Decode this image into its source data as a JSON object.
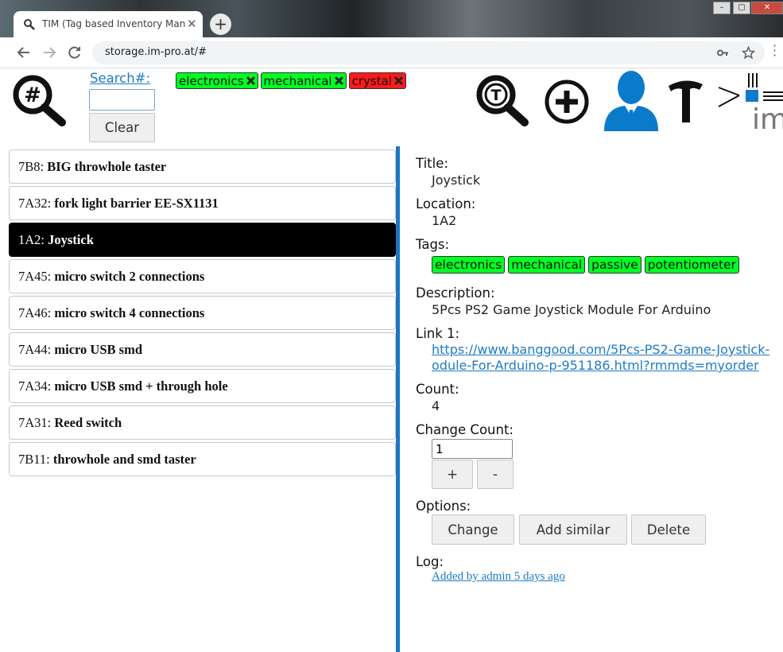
{
  "browser": {
    "tab_title": "TIM (Tag based Inventory Manag",
    "tab_close": "✕",
    "new_tab": "+",
    "url": "storage.im-pro.at/#",
    "window_minimize": "–",
    "window_maximize": "▢",
    "window_close": "✕"
  },
  "header": {
    "search_label": "Search#:",
    "search_value": "",
    "clear_label": "Clear",
    "filter_tags": [
      {
        "label": "electronics",
        "color": "#00ff22"
      },
      {
        "label": "mechanical",
        "color": "#00ff22"
      },
      {
        "label": "crystal",
        "color": "#ff1a1a"
      }
    ]
  },
  "list": {
    "items": [
      {
        "code": "7B8:",
        "name": "BIG throwhole taster",
        "active": false
      },
      {
        "code": "7A32:",
        "name": "fork light barrier EE-SX1131",
        "active": false
      },
      {
        "code": "1A2:",
        "name": "Joystick",
        "active": true
      },
      {
        "code": "7A45:",
        "name": "micro switch 2 connections",
        "active": false
      },
      {
        "code": "7A46:",
        "name": "micro switch 4 connections",
        "active": false
      },
      {
        "code": "7A44:",
        "name": "micro USB smd",
        "active": false
      },
      {
        "code": "7A34:",
        "name": "micro USB smd + through hole",
        "active": false
      },
      {
        "code": "7A31:",
        "name": "Reed switch",
        "active": false
      },
      {
        "code": "7B11:",
        "name": "throwhole and smd taster",
        "active": false
      }
    ]
  },
  "detail": {
    "title_label": "Title:",
    "title_value": "Joystick",
    "location_label": "Location:",
    "location_value": "1A2",
    "tags_label": "Tags:",
    "tags": [
      "electronics",
      "mechanical",
      "passive",
      "potentiometer"
    ],
    "description_label": "Description:",
    "description_value": "5Pcs PS2 Game Joystick Module For Arduino",
    "link_label": "Link 1:",
    "link_line1": "https://www.banggood.com/5Pcs-PS2-Game-Joystick-",
    "link_line2": "odule-For-Arduino-p-951186.html?rmmds=myorder",
    "count_label": "Count:",
    "count_value": "4",
    "change_count_label": "Change Count:",
    "change_count_value": "1",
    "plus_label": "+",
    "minus_label": "-",
    "options_label": "Options:",
    "change_label": "Change",
    "add_similar_label": "Add similar",
    "delete_label": "Delete",
    "log_label": "Log:",
    "log_entry": "Added by admin 5 days ago"
  },
  "colors": {
    "accent": "#1b77c2",
    "tag_green": "#00ff22",
    "tag_red": "#ff1a1a",
    "icon_blue": "#0a7acb"
  }
}
